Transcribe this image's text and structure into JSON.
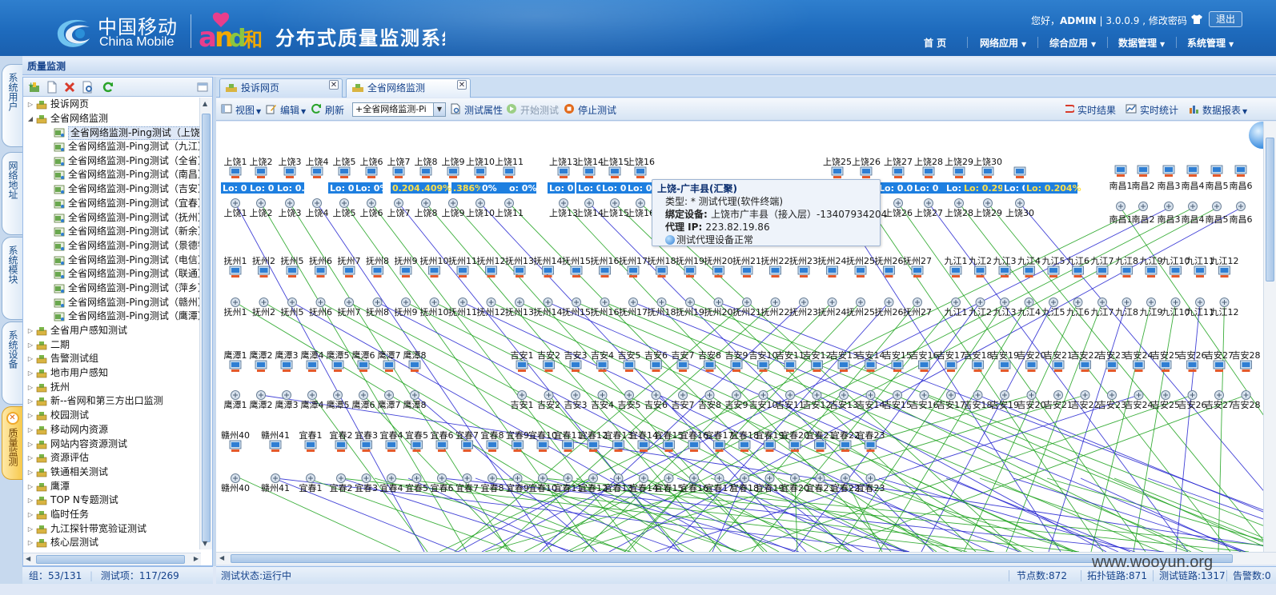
{
  "header": {
    "brand_cn": "中国移动",
    "brand_en": "China Mobile",
    "and_logo": "and和",
    "system_title": "分布式质量监测系统",
    "greeting": "您好，",
    "username": "ADMIN",
    "version_text": " | 3.0.0.9 , ",
    "change_password": "修改密码",
    "logout": "退出",
    "nav": [
      "首 页",
      "网络应用",
      "综合应用",
      "数据管理",
      "系统管理"
    ]
  },
  "vtabs": [
    "系统用户",
    "网络地址",
    "系统模块",
    "系统设备",
    "质量监测"
  ],
  "section_title": "质量监测",
  "tree": [
    {
      "label": "投诉网页",
      "level": 0,
      "expand": "▷",
      "icon": "group"
    },
    {
      "label": "全省网络监测",
      "level": 0,
      "expand": "◢",
      "icon": "group"
    },
    {
      "label": "全省网络监测-Ping测试（上饶）",
      "level": 1,
      "icon": "ping",
      "selected": true
    },
    {
      "label": "全省网络监测-Ping测试（九江）",
      "level": 1,
      "icon": "ping"
    },
    {
      "label": "全省网络监测-Ping测试（全省）",
      "level": 1,
      "icon": "ping"
    },
    {
      "label": "全省网络监测-Ping测试（南昌）",
      "level": 1,
      "icon": "ping"
    },
    {
      "label": "全省网络监测-Ping测试（吉安）",
      "level": 1,
      "icon": "ping"
    },
    {
      "label": "全省网络监测-Ping测试（宜春）",
      "level": 1,
      "icon": "ping"
    },
    {
      "label": "全省网络监测-Ping测试（抚州）",
      "level": 1,
      "icon": "ping"
    },
    {
      "label": "全省网络监测-Ping测试（新余）",
      "level": 1,
      "icon": "ping"
    },
    {
      "label": "全省网络监测-Ping测试（景德镇",
      "level": 1,
      "icon": "ping"
    },
    {
      "label": "全省网络监测-Ping测试（电信）",
      "level": 1,
      "icon": "ping"
    },
    {
      "label": "全省网络监测-Ping测试（联通）",
      "level": 1,
      "icon": "ping"
    },
    {
      "label": "全省网络监测-Ping测试（萍乡）",
      "level": 1,
      "icon": "ping"
    },
    {
      "label": "全省网络监测-Ping测试（赣州）",
      "level": 1,
      "icon": "ping"
    },
    {
      "label": "全省网络监测-Ping测试（鹰潭）",
      "level": 1,
      "icon": "ping"
    },
    {
      "label": "全省用户感知测试",
      "level": 0,
      "expand": "▷",
      "icon": "group"
    },
    {
      "label": "二期",
      "level": 0,
      "expand": "▷",
      "icon": "group"
    },
    {
      "label": "告警测试组",
      "level": 0,
      "expand": "▷",
      "icon": "group"
    },
    {
      "label": "地市用户感知",
      "level": 0,
      "expand": "▷",
      "icon": "group"
    },
    {
      "label": "抚州",
      "level": 0,
      "expand": "▷",
      "icon": "group"
    },
    {
      "label": "新--省网和第三方出口监测",
      "level": 0,
      "expand": "▷",
      "icon": "group"
    },
    {
      "label": "校园测试",
      "level": 0,
      "expand": "▷",
      "icon": "group"
    },
    {
      "label": "移动网内资源",
      "level": 0,
      "expand": "▷",
      "icon": "group"
    },
    {
      "label": "网站内容资源测试",
      "level": 0,
      "expand": "▷",
      "icon": "group"
    },
    {
      "label": "资源评估",
      "level": 0,
      "expand": "▷",
      "icon": "group"
    },
    {
      "label": "铁通相关测试",
      "level": 0,
      "expand": "▷",
      "icon": "group"
    },
    {
      "label": "鹰潭",
      "level": 0,
      "expand": "▷",
      "icon": "group"
    },
    {
      "label": "TOP N专题测试",
      "level": 0,
      "expand": "▷",
      "icon": "group"
    },
    {
      "label": "临时任务",
      "level": 0,
      "expand": "▷",
      "icon": "group"
    },
    {
      "label": "九江探针带宽验证测试",
      "level": 0,
      "expand": "▷",
      "icon": "group"
    },
    {
      "label": "核心层测试",
      "level": 0,
      "expand": "▷",
      "icon": "group"
    }
  ],
  "tabs": [
    {
      "label": "投诉网页",
      "active": false
    },
    {
      "label": "全省网络监测",
      "active": true
    }
  ],
  "toolbar": {
    "view": "视图",
    "edit": "编辑",
    "refresh": "刷新",
    "combo_value": "+全省网络监测-Pi",
    "test_props": "测试属性",
    "start_test": "开始测试",
    "stop_test": "停止测试",
    "realtime_result": "实时结果",
    "realtime_stats": "实时统计",
    "data_report": "数据报表"
  },
  "tooltip": {
    "title": "上饶-广丰县(汇聚)",
    "type_label": "类型: ",
    "type_value": "* 测试代理(软件终端)",
    "device_label": "绑定设备: ",
    "device_value": "上饶市广丰县（接入层）-13407934204",
    "ip_label": "代理 IP: ",
    "ip_value": "223.82.19.86",
    "status": "测试代理设备正常"
  },
  "topology": {
    "row1_top": [
      "上饶1",
      "上饶2",
      "上饶3",
      "上饶4",
      "上饶5",
      "上饶6",
      "上饶7",
      "上饶8",
      "上饶9",
      "上饶10",
      "上饶11"
    ],
    "row1_lo": [
      "Lo: 0",
      "Lo: 0",
      "Lo: 0.4",
      "Lo: 0",
      "Lo: 0%",
      "0.204%",
      ".409%",
      ".386%",
      "0%",
      "o: 0%"
    ],
    "row1_bottom": [
      "上饶1",
      "上饶2",
      "上饶3",
      "上饶4",
      "上饶5",
      "上饶6",
      "上饶7",
      "上饶8",
      "上饶9",
      "上饶10",
      "上饶11"
    ],
    "row1b_top": [
      "上饶13",
      "上饶14",
      "上饶15",
      "上饶16"
    ],
    "row1b_lo": [
      "Lo: 0",
      "Lo: 0.2",
      "Lo: 0",
      "Lo: 0"
    ],
    "row1b_bottom": [
      "上饶13",
      "上饶14",
      "上饶15",
      "上饶16"
    ],
    "row1c_top": [
      "上饶25",
      "上饶26",
      "上饶27",
      "上饶28",
      "上饶29",
      "上饶30"
    ],
    "row1c_lo": [
      "Lo: 0.06",
      "Lo: 0",
      "Lo: 0.2",
      "Lo: 0.29",
      "Lo: 0",
      "Lo: 0.204%"
    ],
    "row1c_bottom": [
      "上饶24",
      "上饶25",
      "上饶26",
      "上饶27",
      "上饶28",
      "上饶29",
      "上饶30"
    ],
    "row1d_top": [
      "南昌1",
      "南昌2",
      "南昌3",
      "南昌4",
      "南昌5",
      "南昌6"
    ],
    "row1d_bottom": [
      "南昌1",
      "南昌2",
      "南昌3",
      "南昌4",
      "南昌5",
      "南昌6"
    ],
    "row2": [
      "抚州1",
      "抚州2",
      "抚州5",
      "抚州6",
      "抚州7",
      "抚州8",
      "抚州9",
      "抚州10",
      "抚州11",
      "抚州12",
      "抚州13",
      "抚州14",
      "抚州15",
      "抚州16",
      "抚州17",
      "抚州18",
      "抚州19",
      "抚州20",
      "抚州21",
      "抚州22",
      "抚州23",
      "抚州24",
      "抚州25",
      "抚州26",
      "抚州27"
    ],
    "row2b": [
      "九江1",
      "九江2",
      "九江3",
      "九江4",
      "九江5",
      "九江6",
      "九江7",
      "九江8",
      "九江9",
      "九江10",
      "九江11",
      "九江12"
    ],
    "row3": [
      "鹰潭1",
      "鹰潭2",
      "鹰潭3",
      "鹰潭4",
      "鹰潭5",
      "鹰潭6",
      "鹰潭7",
      "鹰潭8"
    ],
    "row3b": [
      "吉安1",
      "吉安2",
      "吉安3",
      "吉安4",
      "吉安5",
      "吉安6",
      "吉安7",
      "吉安8",
      "吉安9",
      "吉安10",
      "吉安11",
      "吉安12",
      "吉安13",
      "吉安14",
      "吉安15",
      "吉安16",
      "吉安17",
      "吉安18",
      "吉安19",
      "吉安20",
      "吉安21",
      "吉安22",
      "吉安23",
      "吉安24",
      "吉安25",
      "吉安26",
      "吉安27",
      "吉安28"
    ],
    "row4": [
      "赣州40",
      "赣州41",
      "宜春1",
      "宜春2",
      "宜春3",
      "宜春4",
      "宜春5",
      "宜春6",
      "宜春7",
      "宜春8",
      "宜春9",
      "宜春10",
      "宜春11",
      "宜春12",
      "宜春13",
      "宜春14",
      "宜春15",
      "宜春16",
      "宜春17",
      "宜春18",
      "宜春19",
      "宜春20",
      "宜春21",
      "宜春22",
      "宜春23"
    ]
  },
  "status_left": {
    "group": "组：53/131",
    "items": "测试项：117/269"
  },
  "status_right": {
    "state": "测试状态:运行中",
    "nodes": "节点数:872",
    "topo_links": "拓扑链路:871",
    "test_links": "测试链路:1317",
    "alarms": "告警数:0"
  },
  "watermark": "www.wooyun.org",
  "colors": {
    "header_blue": "#1e6bbd",
    "lo_badge": "#1e7fe0",
    "lo_text_warn": "#ffe14d",
    "link_green": "#1aa11a",
    "link_blue": "#2020d0"
  }
}
